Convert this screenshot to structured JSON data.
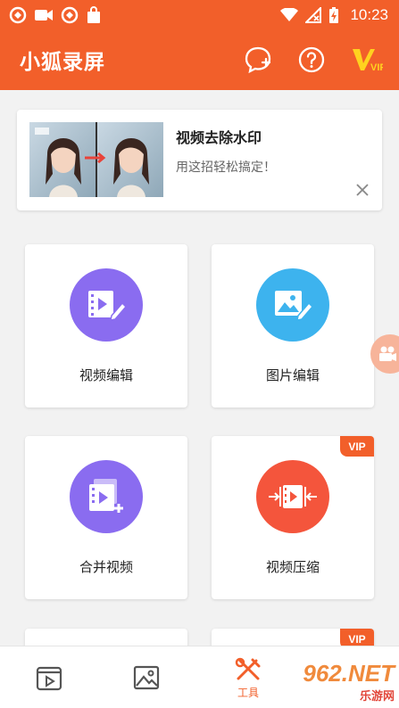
{
  "status_bar": {
    "time": "10:23"
  },
  "app_bar": {
    "title": "小狐录屏",
    "vip_label": "VIP"
  },
  "banner": {
    "title": "视频去除水印",
    "subtitle": "用这招轻松搞定！"
  },
  "tools": [
    {
      "label": "视频编辑",
      "color": "#8a6cf0",
      "icon": "video-edit-icon",
      "vip": false
    },
    {
      "label": "图片编辑",
      "color": "#3db3ee",
      "icon": "image-edit-icon",
      "vip": false
    },
    {
      "label": "合并视频",
      "color": "#8a6cf0",
      "icon": "video-merge-icon",
      "vip": false
    },
    {
      "label": "视频压缩",
      "color": "#f4553c",
      "icon": "video-compress-icon",
      "vip": true,
      "vip_label": "VIP"
    }
  ],
  "row3_vip_label": "VIP",
  "bottom_nav": {
    "active_label": "工具"
  },
  "watermark": {
    "main": "962.NET",
    "sub": "乐游网"
  },
  "colors": {
    "brand": "#f25f2a",
    "purple": "#8a6cf0",
    "blue": "#3db3ee",
    "red": "#f4553c"
  }
}
